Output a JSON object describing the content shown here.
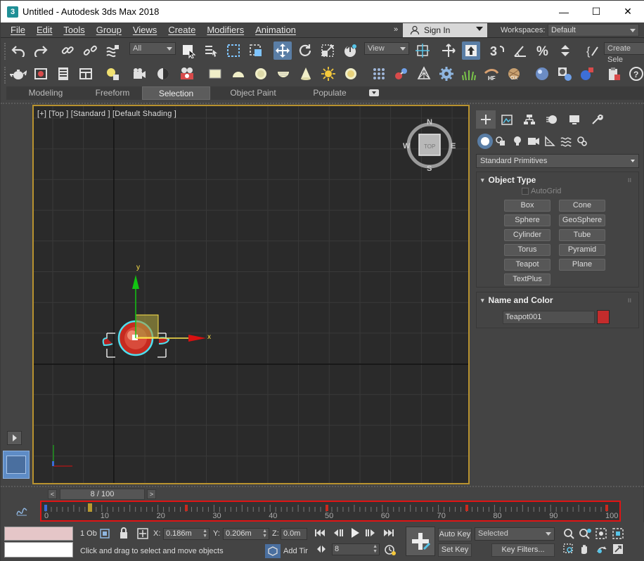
{
  "window": {
    "title": "Untitled - Autodesk 3ds Max 2018",
    "app_icon": "3"
  },
  "controls": {
    "minimize": "—",
    "maximize": "☐",
    "close": "✕"
  },
  "menu": [
    "File",
    "Edit",
    "Tools",
    "Group",
    "Views",
    "Create",
    "Modifiers",
    "Animation"
  ],
  "menu_overflow": "»",
  "signin": {
    "label": "Sign In"
  },
  "workspaces": {
    "label": "Workspaces:",
    "value": "Default"
  },
  "toolbar": {
    "selection_filter": "All",
    "ref_coord": "View",
    "create_selection_set": "Create Sele"
  },
  "ribbon": {
    "tabs": [
      "Modeling",
      "Freeform",
      "Selection",
      "Object Paint",
      "Populate"
    ],
    "active": "Selection"
  },
  "viewport": {
    "label": "[+] [Top ] [Standard ] [Default Shading ]",
    "viewcube": {
      "face": "TOP",
      "n": "N",
      "s": "S",
      "e": "E",
      "w": "W"
    },
    "gizmo": {
      "x": "x",
      "y": "y"
    }
  },
  "command_panel": {
    "category": "Standard Primitives",
    "object_type": {
      "title": "Object Type",
      "autogrid": "AutoGrid",
      "buttons": [
        "Box",
        "Cone",
        "Sphere",
        "GeoSphere",
        "Cylinder",
        "Tube",
        "Torus",
        "Pyramid",
        "Teapot",
        "Plane",
        "TextPlus"
      ]
    },
    "name_color": {
      "title": "Name and Color",
      "name": "Teapot001",
      "color": "#c42c2c"
    }
  },
  "timeslider": {
    "label": "8 / 100",
    "prev": "<",
    "next": ">"
  },
  "timeline": {
    "ticks": [
      "0",
      "10",
      "20",
      "30",
      "40",
      "50",
      "60",
      "70",
      "80",
      "90",
      "100"
    ],
    "current_frame": 8
  },
  "status": {
    "selected_count": "1 Ob",
    "prompt": "Click and drag to select and move objects",
    "x_label": "X:",
    "x_value": "0.186m",
    "y_label": "Y:",
    "y_value": "0.206m",
    "z_label": "Z:",
    "z_value": "0.0m",
    "add_time_tag": "Add Tir",
    "frame_value": "8",
    "auto_key": "Auto Key",
    "set_key": "Set Key",
    "key_mode": "Selected",
    "key_filters": "Key Filters..."
  }
}
